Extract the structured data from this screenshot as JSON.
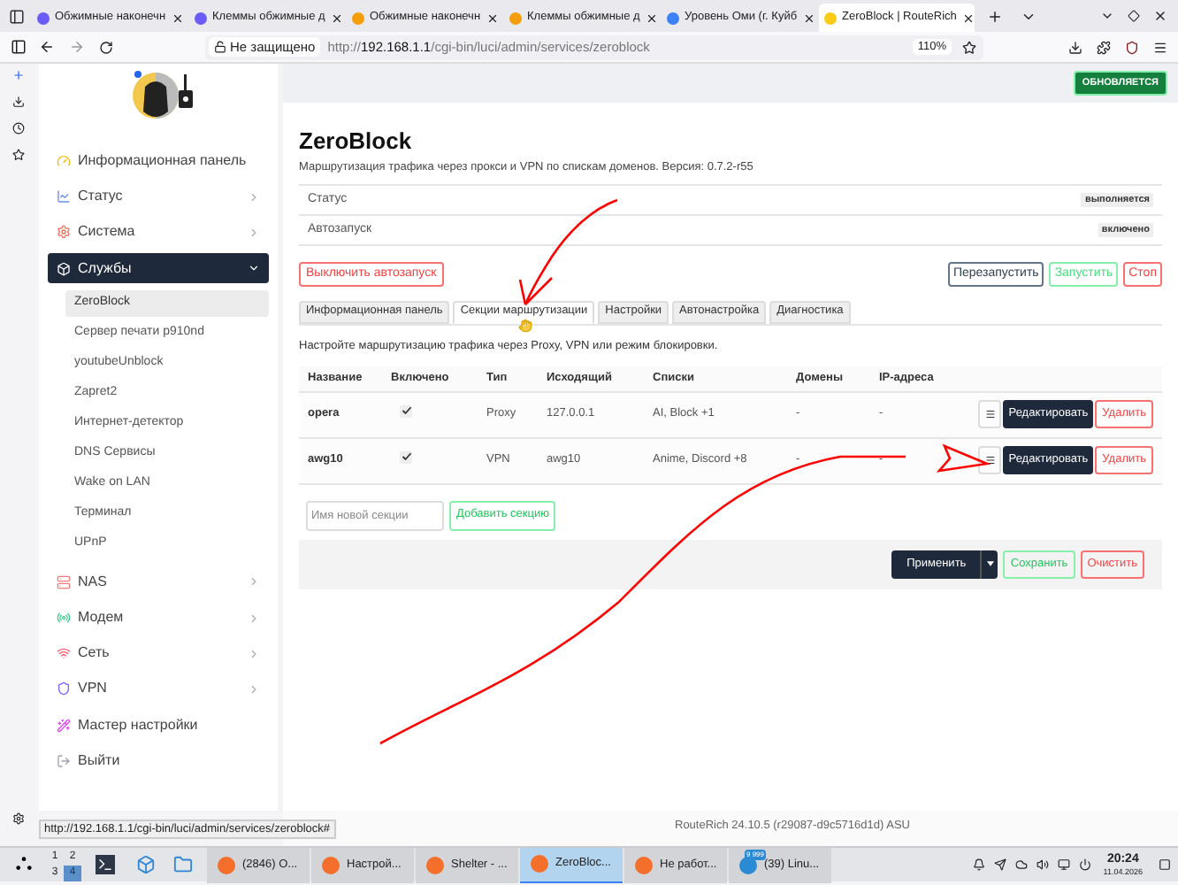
{
  "browser": {
    "tabs": [
      {
        "title": "Обжимные наконечн",
        "selected": false
      },
      {
        "title": "Клеммы обжимные д",
        "selected": false
      },
      {
        "title": "Обжимные наконечн",
        "selected": false
      },
      {
        "title": "Клеммы обжимные д",
        "selected": false
      },
      {
        "title": "Уровень Оми (г. Куйб",
        "selected": false
      },
      {
        "title": "ZeroBlock | RouteRich",
        "selected": true
      }
    ],
    "security": "Не защищено",
    "url": {
      "scheme": "http://",
      "host": "192.168.1.1",
      "path": "/cgi-bin/luci/admin/services/zeroblock"
    },
    "zoom": "110%"
  },
  "sidebar": {
    "items": [
      {
        "label": "Информационная панель",
        "kind": "link",
        "expanded": false
      },
      {
        "label": "Статус",
        "kind": "group",
        "expanded": false
      },
      {
        "label": "Система",
        "kind": "group",
        "expanded": false
      },
      {
        "label": "Службы",
        "kind": "group",
        "expanded": true,
        "children": [
          {
            "label": "ZeroBlock",
            "selected": true
          },
          {
            "label": "Сервер печати p910nd",
            "selected": false
          },
          {
            "label": "youtubeUnblock",
            "selected": false
          },
          {
            "label": "Zapret2",
            "selected": false
          },
          {
            "label": "Интернет-детектор",
            "selected": false
          },
          {
            "label": "DNS Сервисы",
            "selected": false
          },
          {
            "label": "Wake on LAN",
            "selected": false
          },
          {
            "label": "Терминал",
            "selected": false
          },
          {
            "label": "UPnP",
            "selected": false
          }
        ]
      },
      {
        "label": "NAS",
        "kind": "group",
        "expanded": false
      },
      {
        "label": "Модем",
        "kind": "group",
        "expanded": false
      },
      {
        "label": "Сеть",
        "kind": "group",
        "expanded": false
      },
      {
        "label": "VPN",
        "kind": "group",
        "expanded": false
      },
      {
        "label": "Мастер настройки",
        "kind": "link",
        "expanded": false
      },
      {
        "label": "Выйти",
        "kind": "link",
        "expanded": false
      }
    ]
  },
  "header_badge": "ОБНОВЛЯЕТСЯ",
  "page": {
    "title": "ZeroBlock",
    "subtitle": "Маршрутизация трафика через прокси и VPN по спискам доменов. Версия: 0.7.2-r55",
    "status_rows": [
      {
        "label": "Статус",
        "value": "выполняется"
      },
      {
        "label": "Автозапуск",
        "value": "включено"
      }
    ],
    "autostart_button": "Выключить автозапуск",
    "service_buttons": [
      {
        "label": "Перезапустить",
        "kind": "neutral"
      },
      {
        "label": "Запустить",
        "kind": "positive"
      },
      {
        "label": "Стоп",
        "kind": "negative"
      }
    ],
    "tabs": [
      {
        "label": "Информационная панель",
        "selected": false
      },
      {
        "label": "Секции маршрутизации",
        "selected": true
      },
      {
        "label": "Настройки",
        "selected": false
      },
      {
        "label": "Автонастройка",
        "selected": false
      },
      {
        "label": "Диагностика",
        "selected": false
      }
    ],
    "description": "Настройте маршрутизацию трафика через Proxy, VPN или режим блокировки.",
    "table": {
      "columns": [
        "Название",
        "Включено",
        "Тип",
        "Исходящий",
        "Списки",
        "Домены",
        "IP-адреса"
      ],
      "rows": [
        {
          "name": "opera",
          "enabled": true,
          "type": "Proxy",
          "outbound": "127.0.0.1",
          "lists": "AI, Block +1",
          "domains": "-",
          "ips": "-",
          "edit": "Редактировать",
          "delete": "Удалить"
        },
        {
          "name": "awg10",
          "enabled": true,
          "type": "VPN",
          "outbound": "awg10",
          "lists": "Anime, Discord +8",
          "domains": "-",
          "ips": "-",
          "edit": "Редактировать",
          "delete": "Удалить"
        }
      ]
    },
    "new_section": {
      "placeholder": "Имя новой секции",
      "button": "Добавить секцию"
    },
    "footer_buttons": {
      "apply": "Применить",
      "save": "Сохранить",
      "reset": "Очистить"
    }
  },
  "status_url": "http://192.168.1.1/cgi-bin/luci/admin/services/zeroblock#",
  "footer_text": "RouteRich 24.10.5 (r29087-d9c5716d1d) ASU",
  "taskbar": {
    "desktops": [
      {
        "label": "1",
        "selected": false
      },
      {
        "label": "2",
        "selected": false
      },
      {
        "label": "3",
        "selected": false
      },
      {
        "label": "4",
        "selected": true
      }
    ],
    "windows": [
      {
        "title": "(2846) О...",
        "selected": false
      },
      {
        "title": "Настрой...",
        "selected": false
      },
      {
        "title": "Shelter - ...",
        "selected": false
      },
      {
        "title": "ZeroBloc...",
        "selected": true
      },
      {
        "title": "Не работ...",
        "selected": false
      },
      {
        "title": "(39) Linu...",
        "selected": false,
        "badge": "9 999"
      }
    ],
    "time": "20:24",
    "date": "11.04.2026"
  }
}
